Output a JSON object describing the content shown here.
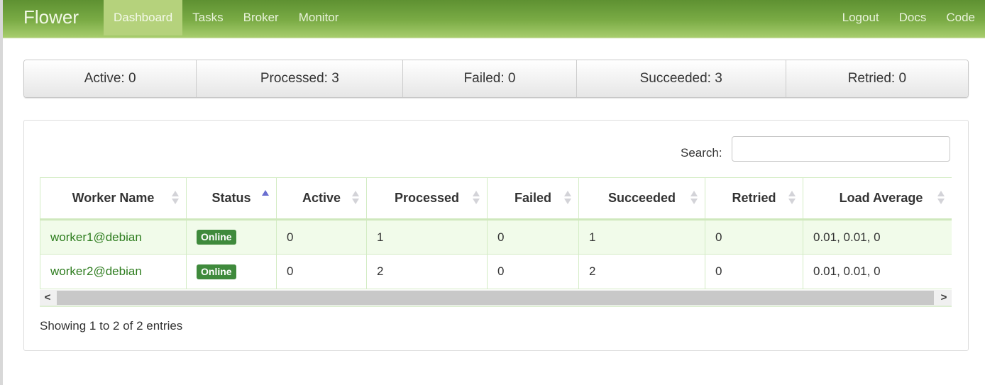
{
  "navbar": {
    "brand": "Flower",
    "left_items": [
      {
        "label": "Dashboard",
        "active": true
      },
      {
        "label": "Tasks",
        "active": false
      },
      {
        "label": "Broker",
        "active": false
      },
      {
        "label": "Monitor",
        "active": false
      }
    ],
    "right_items": [
      {
        "label": "Logout"
      },
      {
        "label": "Docs"
      },
      {
        "label": "Code"
      }
    ]
  },
  "stats": [
    {
      "label": "Active: 0"
    },
    {
      "label": "Processed: 3"
    },
    {
      "label": "Failed: 0"
    },
    {
      "label": "Succeeded: 3"
    },
    {
      "label": "Retried: 0"
    }
  ],
  "search": {
    "label": "Search:",
    "value": "",
    "placeholder": ""
  },
  "table": {
    "columns": [
      {
        "label": "Worker Name",
        "sort": "none"
      },
      {
        "label": "Status",
        "sort": "asc"
      },
      {
        "label": "Active",
        "sort": "none"
      },
      {
        "label": "Processed",
        "sort": "none"
      },
      {
        "label": "Failed",
        "sort": "none"
      },
      {
        "label": "Succeeded",
        "sort": "none"
      },
      {
        "label": "Retried",
        "sort": "none"
      },
      {
        "label": "Load Average",
        "sort": "none"
      }
    ],
    "rows": [
      {
        "worker": "worker1@debian",
        "status": "Online",
        "active": "0",
        "processed": "1",
        "failed": "0",
        "succeeded": "1",
        "retried": "0",
        "load": "0.01, 0.01, 0"
      },
      {
        "worker": "worker2@debian",
        "status": "Online",
        "active": "0",
        "processed": "2",
        "failed": "0",
        "succeeded": "2",
        "retried": "0",
        "load": "0.01, 0.01, 0"
      }
    ]
  },
  "scrollbar": {
    "left_arrow": "<",
    "right_arrow": ">"
  },
  "info": "Showing 1 to 2 of 2 entries",
  "colors": {
    "nav_green": "#7aab45",
    "active_tab": "#b5d27c",
    "badge_green": "#3f8a3c",
    "link_green": "#2e7d1f",
    "sort_active": "#6a6fd0"
  }
}
